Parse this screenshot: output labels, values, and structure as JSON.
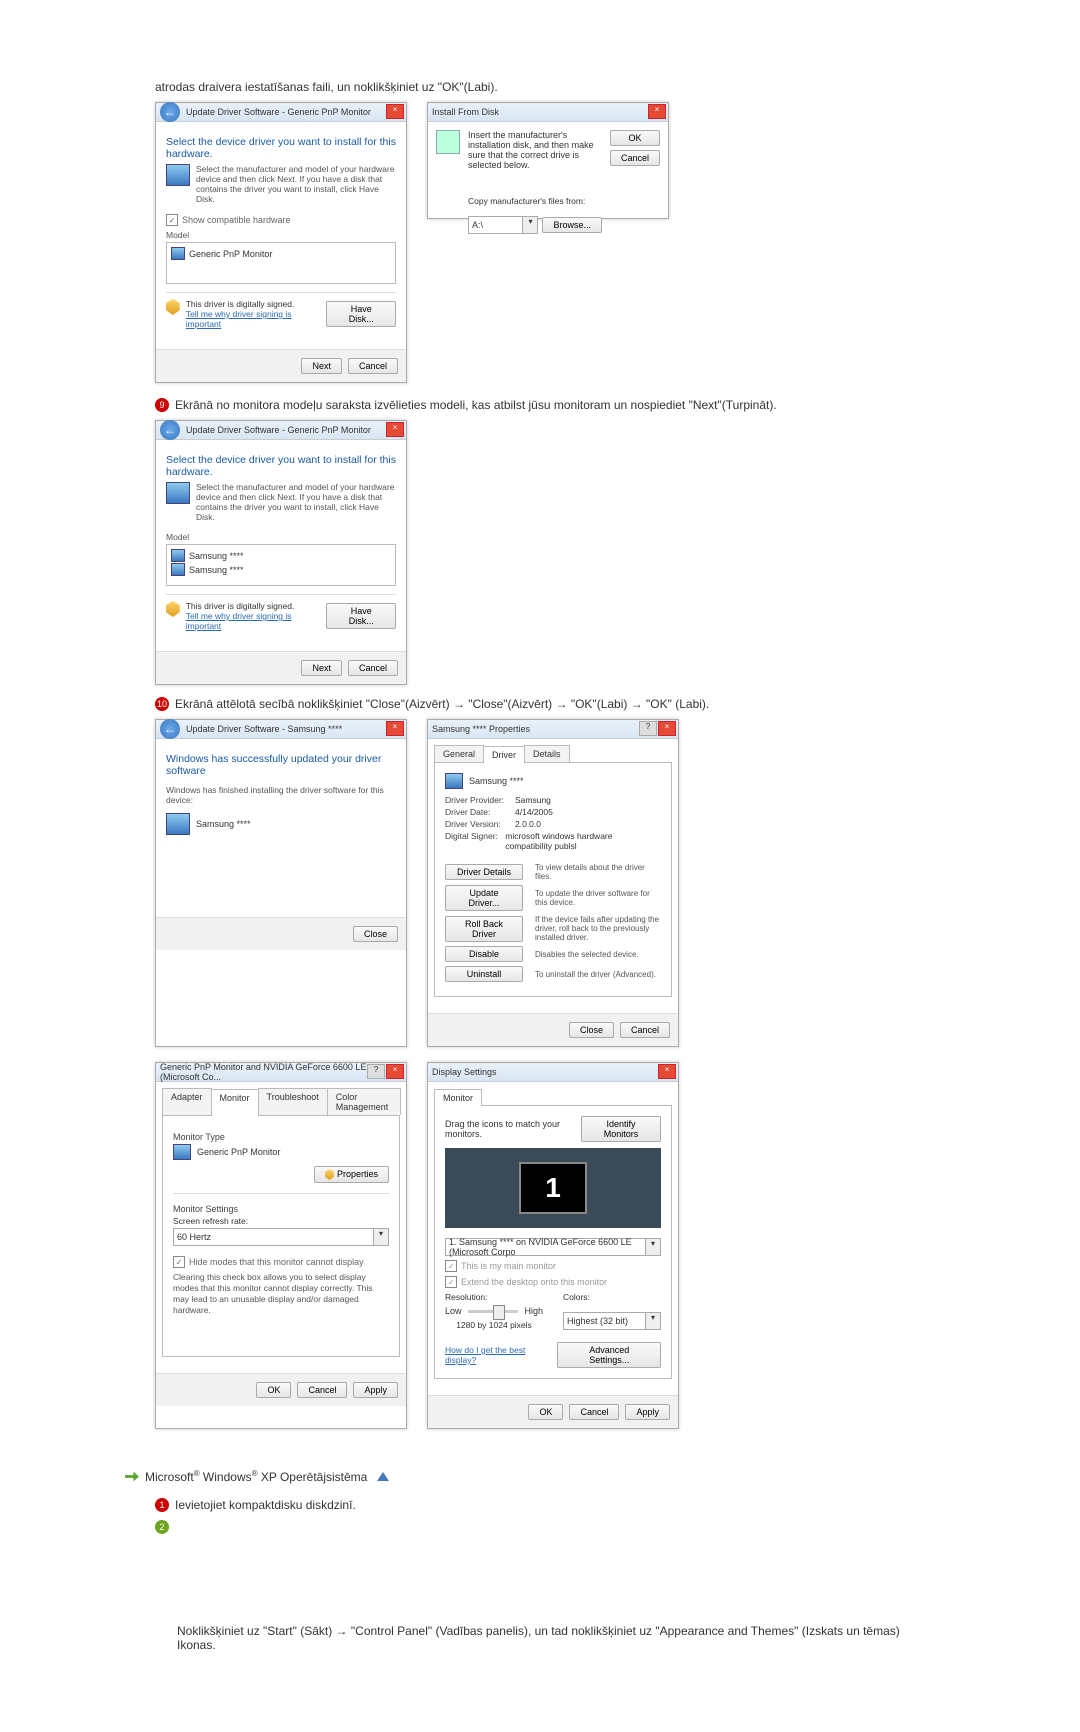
{
  "intro": "atrodas draivera iestatīšanas faili, un noklikšķiniet uz \"OK\"(Labi).",
  "dialog1": {
    "title": "Update Driver Software - Generic PnP Monitor",
    "heading": "Select the device driver you want to install for this hardware.",
    "hint": "Select the manufacturer and model of your hardware device and then click Next. If you have a disk that contains the driver you want to install, click Have Disk.",
    "show_compat": "Show compatible hardware",
    "model_label": "Model",
    "item1": "Generic PnP Monitor",
    "signed": "This driver is digitally signed.",
    "why_link": "Tell me why driver signing is important",
    "have_disk": "Have Disk...",
    "next": "Next",
    "cancel": "Cancel"
  },
  "install_from_disk": {
    "title": "Install From Disk",
    "msg": "Insert the manufacturer's installation disk, and then make sure that the correct drive is selected below.",
    "ok": "OK",
    "cancel": "Cancel",
    "copy_label": "Copy manufacturer's files from:",
    "path": "A:\\",
    "browse": "Browse..."
  },
  "step9": "Ekrānā no monitora modeļu saraksta izvēlieties modeli, kas atbilst jūsu monitoram un nospiediet \"Next\"(Turpināt).",
  "dialog2": {
    "title": "Update Driver Software - Generic PnP Monitor",
    "heading": "Select the device driver you want to install for this hardware.",
    "hint": "Select the manufacturer and model of your hardware device and then click Next. If you have a disk that contains the driver you want to install, click Have Disk.",
    "model_label": "Model",
    "item1": "Samsung ****",
    "item2": "Samsung ****",
    "signed": "This driver is digitally signed.",
    "why_link": "Tell me why driver signing is important",
    "have_disk": "Have Disk...",
    "next": "Next",
    "cancel": "Cancel"
  },
  "step10": "Ekrānā attēlotā secībā noklikšķiniet \"Close\"(Aizvērt) → \"Close\"(Aizvērt) → \"OK\"(Labi) → \"OK\" (Labi).",
  "dialog3": {
    "title": "Update Driver Software - Samsung ****",
    "success": "Windows has successfully updated your driver software",
    "finished": "Windows has finished installing the driver software for this device:",
    "model": "Samsung ****",
    "close": "Close"
  },
  "properties": {
    "title": "Samsung **** Properties",
    "tabs": {
      "general": "General",
      "driver": "Driver",
      "details": "Details"
    },
    "device": "Samsung ****",
    "provider_k": "Driver Provider:",
    "provider_v": "Samsung",
    "date_k": "Driver Date:",
    "date_v": "4/14/2005",
    "version_k": "Driver Version:",
    "version_v": "2.0.0.0",
    "signer_k": "Digital Signer:",
    "signer_v": "microsoft windows hardware compatibility publsl",
    "btn_details": "Driver Details",
    "desc_details": "To view details about the driver files.",
    "btn_update": "Update Driver...",
    "desc_update": "To update the driver software for this device.",
    "btn_rollback": "Roll Back Driver",
    "desc_rollback": "If the device fails after updating the driver, roll back to the previously installed driver.",
    "btn_disable": "Disable",
    "desc_disable": "Disables the selected device.",
    "btn_uninstall": "Uninstall",
    "desc_uninstall": "To uninstall the driver (Advanced).",
    "close": "Close",
    "cancel": "Cancel"
  },
  "generic_pnp": {
    "title": "Generic PnP Monitor and NVIDIA GeForce 6600 LE (Microsoft Co...",
    "tabs": {
      "adapter": "Adapter",
      "monitor": "Monitor",
      "ts": "Troubleshoot",
      "cm": "Color Management"
    },
    "type_lbl": "Monitor Type",
    "type_val": "Generic PnP Monitor",
    "props_btn": "Properties",
    "settings_lbl": "Monitor Settings",
    "refresh_lbl": "Screen refresh rate:",
    "refresh_val": "60 Hertz",
    "hide_cb": "Hide modes that this monitor cannot display",
    "hide_desc": "Clearing this check box allows you to select display modes that this monitor cannot display correctly. This may lead to an unusable display and/or damaged hardware.",
    "ok": "OK",
    "cancel": "Cancel",
    "apply": "Apply"
  },
  "display_settings": {
    "title": "Display Settings",
    "tab": "Monitor",
    "drag": "Drag the icons to match your monitors.",
    "identify": "Identify Monitors",
    "num": "1",
    "sel": "1. Samsung **** on NVIDIA GeForce 6600 LE (Microsoft Corpo",
    "main_cb": "This is my main monitor",
    "extend_cb": "Extend the desktop onto this monitor",
    "res_lbl": "Resolution:",
    "low": "Low",
    "high": "High",
    "res_val": "1280 by 1024 pixels",
    "colors_lbl": "Colors:",
    "colors_val": "Highest (32 bit)",
    "best_link": "How do I get the best display?",
    "adv": "Advanced Settings...",
    "ok": "OK",
    "cancel": "Cancel",
    "apply": "Apply"
  },
  "os_section": {
    "label_pre": "Microsoft",
    "label_mid": " Windows",
    "label_suf": " XP Operētājsistēma"
  },
  "step_xp1": "Ievietojiet kompaktdisku diskdzinī.",
  "bottom": "Noklikšķiniet uz \"Start\" (Sākt) → \"Control Panel\" (Vadības panelis), un tad noklikšķiniet uz \"Appearance and Themes\" (Izskats un tēmas) Ikonas."
}
